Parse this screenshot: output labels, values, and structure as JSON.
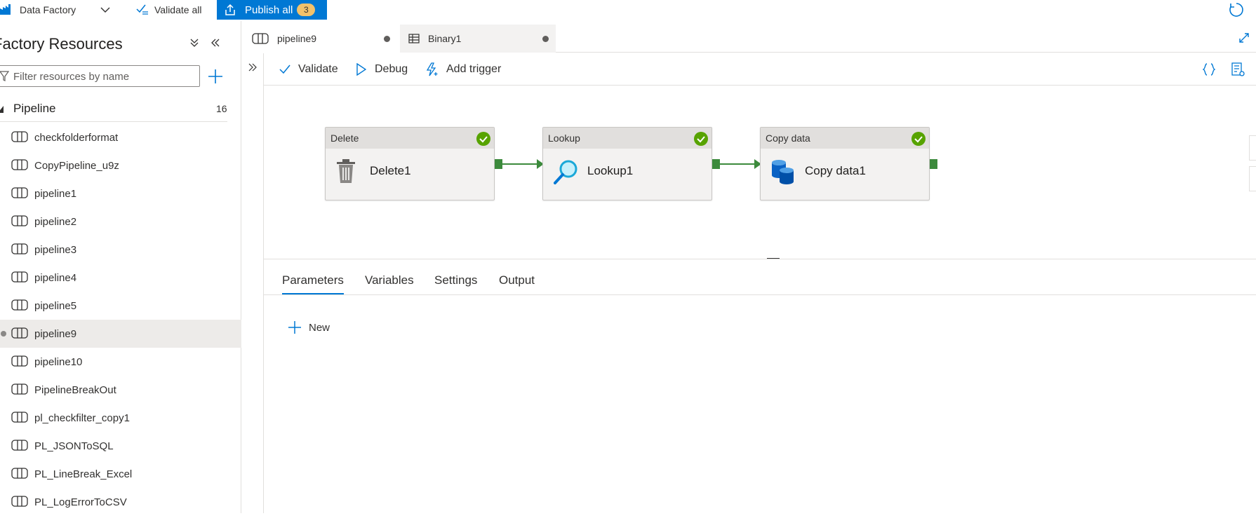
{
  "app": {
    "name": "Data Factory",
    "validate_all": "Validate all",
    "publish_all": "Publish all",
    "publish_count": "3"
  },
  "resources": {
    "title": "Factory Resources",
    "filter_placeholder": "Filter resources by name",
    "category": "Pipeline",
    "category_count": "16",
    "items": [
      "checkfolderformat",
      "CopyPipeline_u9z",
      "pipeline1",
      "pipeline2",
      "pipeline3",
      "pipeline4",
      "pipeline5",
      "pipeline9",
      "pipeline10",
      "PipelineBreakOut",
      "pl_checkfilter_copy1",
      "PL_JSONToSQL",
      "PL_LineBreak_Excel",
      "PL_LogErrorToCSV"
    ],
    "selected_item": "pipeline9"
  },
  "tabs": [
    {
      "label": "pipeline9"
    },
    {
      "label": "Binary1"
    }
  ],
  "toolbar": {
    "validate": "Validate",
    "debug": "Debug",
    "add_trigger": "Add trigger"
  },
  "activities": [
    {
      "type": "Delete",
      "name": "Delete1"
    },
    {
      "type": "Lookup",
      "name": "Lookup1"
    },
    {
      "type": "Copy data",
      "name": "Copy data1"
    }
  ],
  "bottom_tabs": [
    {
      "label": "Parameters",
      "active": true
    },
    {
      "label": "Variables"
    },
    {
      "label": "Settings"
    },
    {
      "label": "Output"
    }
  ],
  "parameters": {
    "new_label": "New"
  },
  "colors": {
    "accent": "#0078d4",
    "success": "#57a300",
    "connector": "#3c8a3c",
    "badge": "#f2c26b"
  }
}
